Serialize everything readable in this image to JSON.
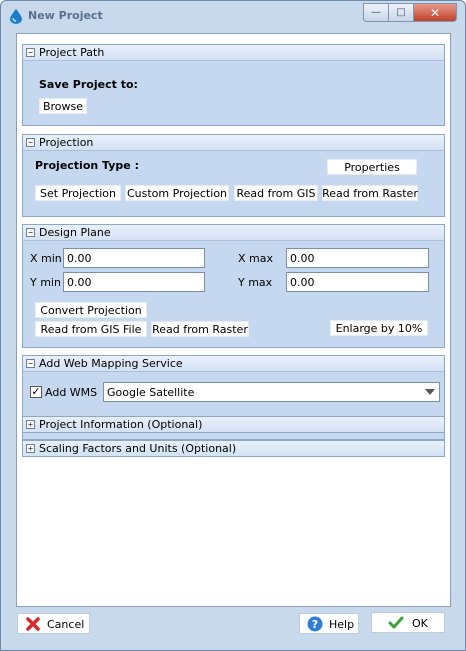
{
  "window": {
    "title": "New Project",
    "minimize": "—",
    "maximize": "□",
    "close": "✕"
  },
  "project_path": {
    "header": "Project Path",
    "save_label": "Save Project to:",
    "browse_button": "Browse"
  },
  "projection": {
    "header": "Projection",
    "type_label": "Projection Type :",
    "properties_button": "Properties",
    "set_projection_button": "Set Projection",
    "custom_projection_button": "Custom Projection",
    "read_from_gis_button": "Read from GIS",
    "read_from_raster_button": "Read from Raster"
  },
  "design_plane": {
    "header": "Design Plane",
    "xmin_label": "X min",
    "xmin_value": "0.00",
    "xmax_label": "X max",
    "xmax_value": "0.00",
    "ymin_label": "Y min",
    "ymin_value": "0.00",
    "ymax_label": "Y max",
    "ymax_value": "0.00",
    "convert_projection_button": "Convert Projection",
    "read_from_gis_file_button": "Read from GIS File",
    "read_from_raster_button": "Read from Raster",
    "enlarge_button": "Enlarge by 10%"
  },
  "wms": {
    "header": "Add Web Mapping Service",
    "add_wms_label": "Add WMS",
    "add_wms_checked": "✓",
    "service_selected": "Google Satellite"
  },
  "project_information": {
    "header": "Project Information (Optional)"
  },
  "scaling": {
    "header": "Scaling Factors and Units (Optional)"
  },
  "toggles": {
    "expanded": "−",
    "collapsed": "+"
  },
  "footer": {
    "cancel_button": "Cancel",
    "help_button": "Help",
    "ok_button": "OK"
  },
  "colors": {
    "window_frame": "#c9d9ec",
    "group_fill": "#c5d8ef",
    "cancel_icon": "#d8282a",
    "help_icon": "#2f7fd6",
    "ok_icon": "#3aa335"
  },
  "icons": [
    "app-drop-icon",
    "cancel-x-icon",
    "help-question-icon",
    "ok-check-icon"
  ]
}
